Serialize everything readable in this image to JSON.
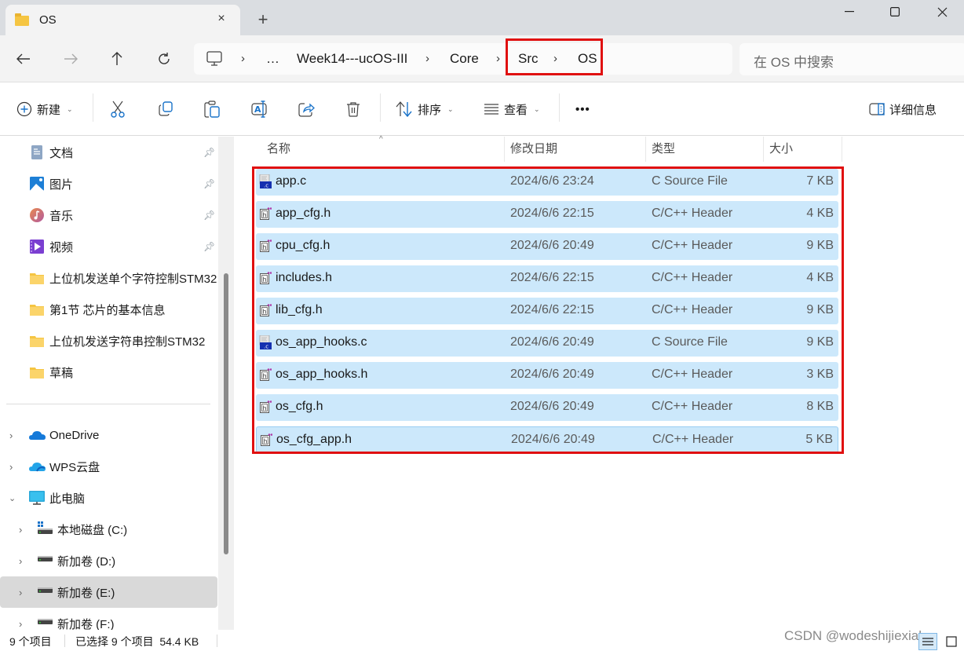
{
  "window": {
    "tab_title": "OS",
    "tab_close_icon": "×",
    "new_tab_icon": "+"
  },
  "address": {
    "breadcrumbs": [
      "…",
      "Week14---ucOS-III",
      "Core",
      "Src",
      "OS"
    ],
    "separator": "›"
  },
  "search": {
    "placeholder": "在 OS 中搜索"
  },
  "toolbar": {
    "new_label": "新建",
    "sort_label": "排序",
    "view_label": "查看",
    "more_label": "•••",
    "details_label": "详细信息"
  },
  "sidebar": {
    "quick_access": [
      {
        "label": "文档",
        "icon": "documents-icon",
        "pinned": true
      },
      {
        "label": "图片",
        "icon": "pictures-icon",
        "pinned": true
      },
      {
        "label": "音乐",
        "icon": "music-icon",
        "pinned": true
      },
      {
        "label": "视频",
        "icon": "videos-icon",
        "pinned": true
      },
      {
        "label": "上位机发送单个字符控制STM32",
        "icon": "folder-icon",
        "pinned": false
      },
      {
        "label": "第1节 芯片的基本信息",
        "icon": "folder-icon",
        "pinned": false
      },
      {
        "label": "上位机发送字符串控制STM32",
        "icon": "folder-icon",
        "pinned": false
      },
      {
        "label": "草稿",
        "icon": "folder-icon",
        "pinned": false
      }
    ],
    "locations": [
      {
        "label": "OneDrive",
        "icon": "onedrive-icon",
        "expanded": false
      },
      {
        "label": "WPS云盘",
        "icon": "wps-cloud-icon",
        "expanded": false
      },
      {
        "label": "此电脑",
        "icon": "this-pc-icon",
        "expanded": true
      },
      {
        "label": "本地磁盘 (C:)",
        "icon": "system-drive-icon",
        "expanded": false
      },
      {
        "label": "新加卷 (D:)",
        "icon": "drive-icon",
        "expanded": false
      },
      {
        "label": "新加卷 (E:)",
        "icon": "drive-icon",
        "expanded": false,
        "selected": true
      },
      {
        "label": "新加卷 (F:)",
        "icon": "drive-icon",
        "expanded": false
      }
    ]
  },
  "file_list": {
    "columns": [
      "名称",
      "修改日期",
      "类型",
      "大小"
    ],
    "sort_indicator": "^",
    "files": [
      {
        "name": "app.c",
        "date": "2024/6/6 23:24",
        "type": "C Source File",
        "size": "7 KB",
        "kind": "c"
      },
      {
        "name": "app_cfg.h",
        "date": "2024/6/6 22:15",
        "type": "C/C++ Header",
        "size": "4 KB",
        "kind": "h"
      },
      {
        "name": "cpu_cfg.h",
        "date": "2024/6/6 20:49",
        "type": "C/C++ Header",
        "size": "9 KB",
        "kind": "h"
      },
      {
        "name": "includes.h",
        "date": "2024/6/6 22:15",
        "type": "C/C++ Header",
        "size": "4 KB",
        "kind": "h"
      },
      {
        "name": "lib_cfg.h",
        "date": "2024/6/6 22:15",
        "type": "C/C++ Header",
        "size": "9 KB",
        "kind": "h"
      },
      {
        "name": "os_app_hooks.c",
        "date": "2024/6/6 20:49",
        "type": "C Source File",
        "size": "9 KB",
        "kind": "c"
      },
      {
        "name": "os_app_hooks.h",
        "date": "2024/6/6 20:49",
        "type": "C/C++ Header",
        "size": "3 KB",
        "kind": "h"
      },
      {
        "name": "os_cfg.h",
        "date": "2024/6/6 20:49",
        "type": "C/C++ Header",
        "size": "8 KB",
        "kind": "h"
      },
      {
        "name": "os_cfg_app.h",
        "date": "2024/6/6 20:49",
        "type": "C/C++ Header",
        "size": "5 KB",
        "kind": "h"
      }
    ]
  },
  "status": {
    "item_count": "9 个项目",
    "selection": "已选择 9 个项目  54.4 KB"
  },
  "watermark": "CSDN @wodeshijiexialey",
  "colors": {
    "highlight": "#e01010",
    "selection_bg": "#cce8fb",
    "accent": "#1a73c9"
  }
}
